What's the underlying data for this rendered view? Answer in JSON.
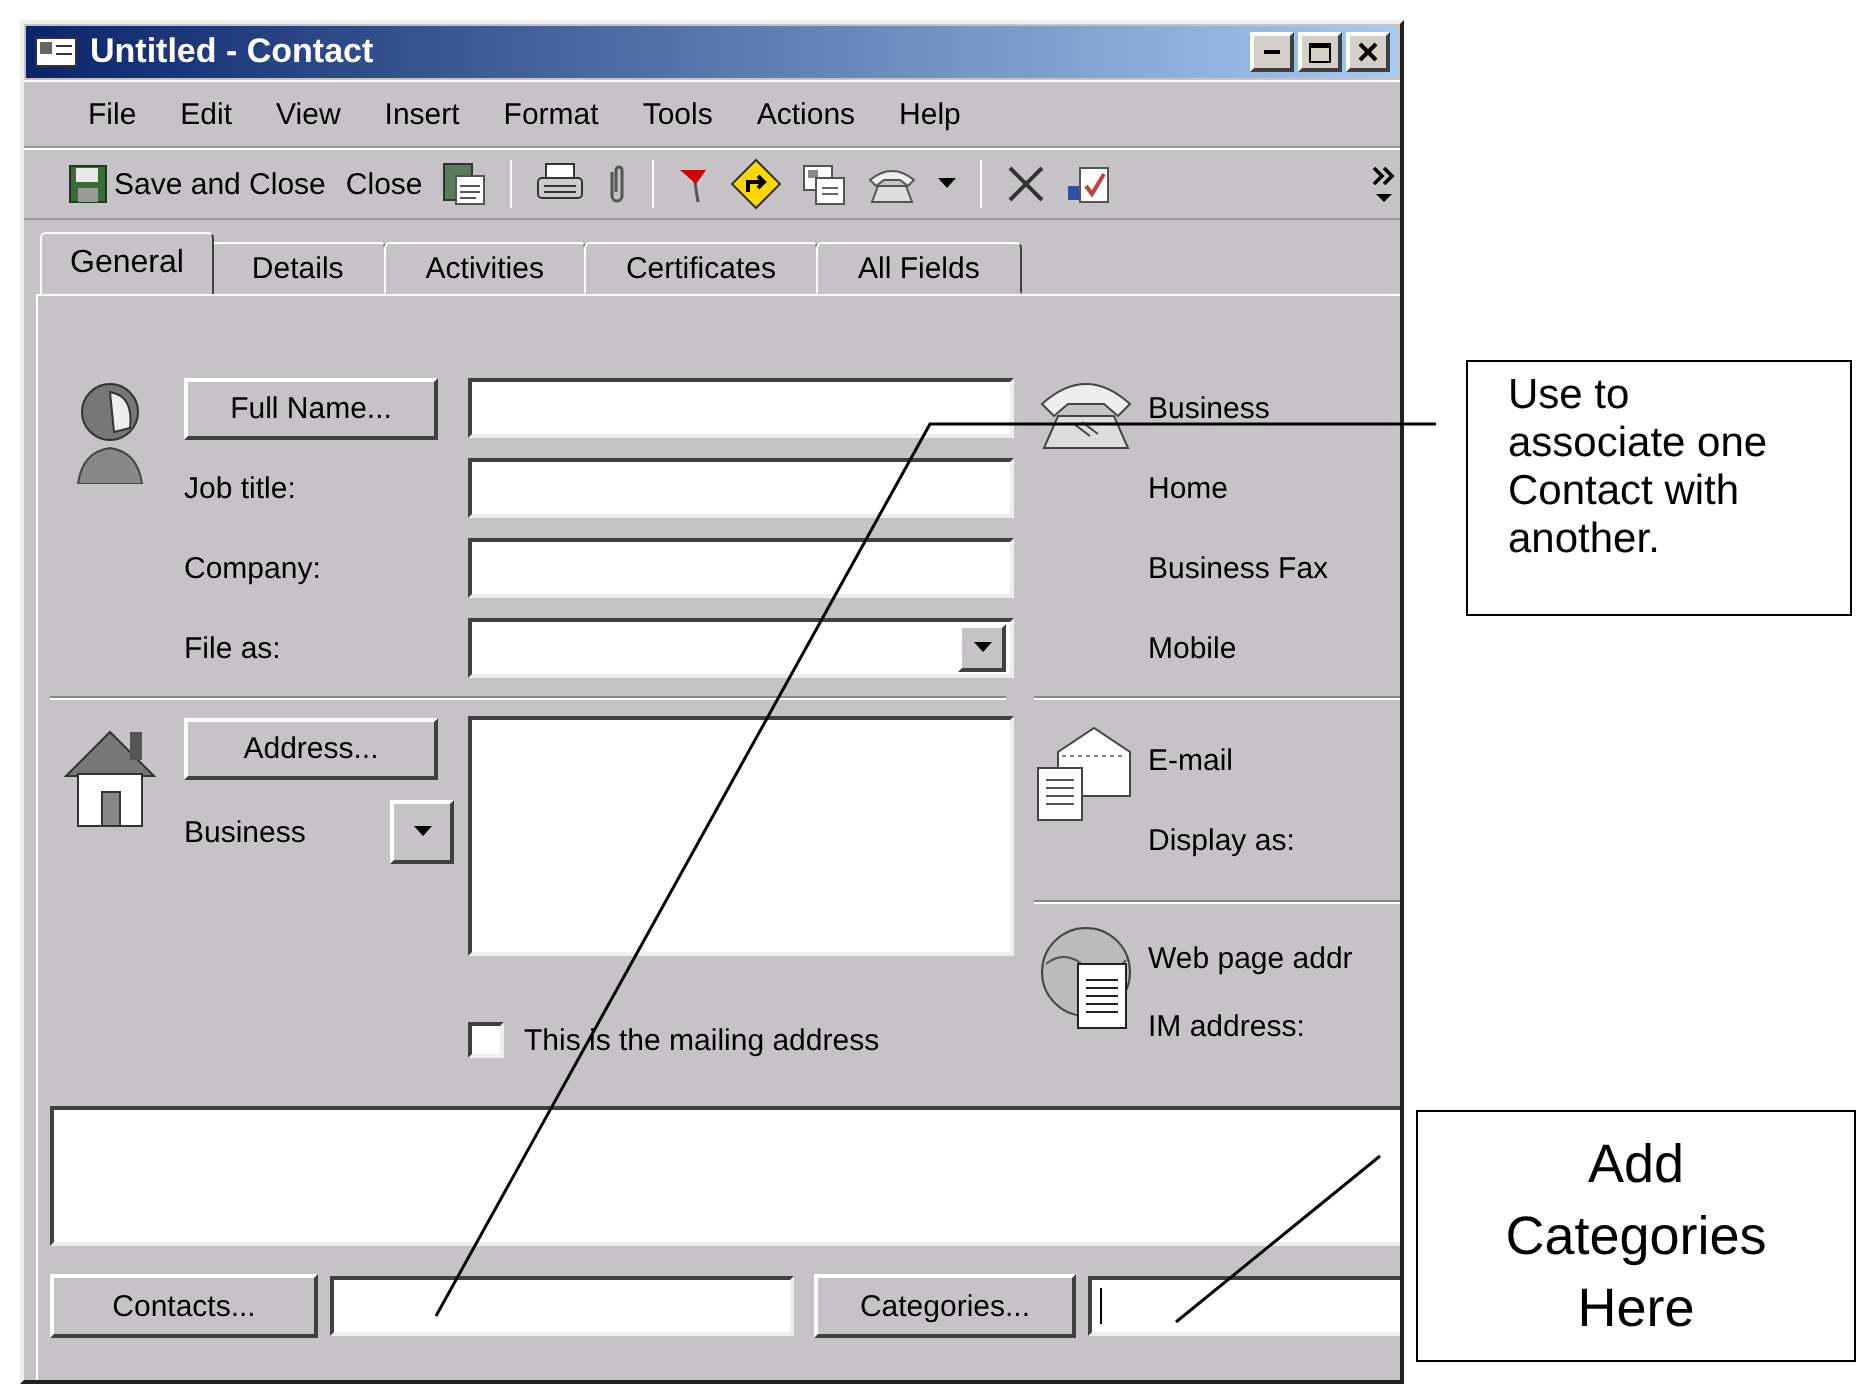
{
  "window": {
    "title": "Untitled - Contact"
  },
  "menu": [
    "File",
    "Edit",
    "View",
    "Insert",
    "Format",
    "Tools",
    "Actions",
    "Help"
  ],
  "toolbar": {
    "save_label": "Save and Close",
    "close_label": "Close"
  },
  "tabs": [
    {
      "label": "General",
      "selected": true
    },
    {
      "label": "Details",
      "selected": false
    },
    {
      "label": "Activities",
      "selected": false
    },
    {
      "label": "Certificates",
      "selected": false
    },
    {
      "label": "All Fields",
      "selected": false
    }
  ],
  "general": {
    "name_button": "Full Name...",
    "name_labels": [
      "Job title:",
      "Company:",
      "File as:"
    ],
    "address_button": "Address...",
    "address_type": "Business",
    "mailing_checkbox": {
      "label": "This is the mailing address",
      "checked": false
    },
    "phone_labels": [
      "Business",
      "Home",
      "Business Fax",
      "Mobile"
    ],
    "email_labels": [
      "E-mail",
      "Display as:"
    ],
    "web_labels": [
      "Web page addr",
      "IM address:"
    ],
    "contacts_button": "Contacts...",
    "categories_button": "Categories..."
  },
  "callouts": [
    {
      "text": "Use to associate one Contact with another."
    },
    {
      "text": "Add Categories Here"
    }
  ]
}
